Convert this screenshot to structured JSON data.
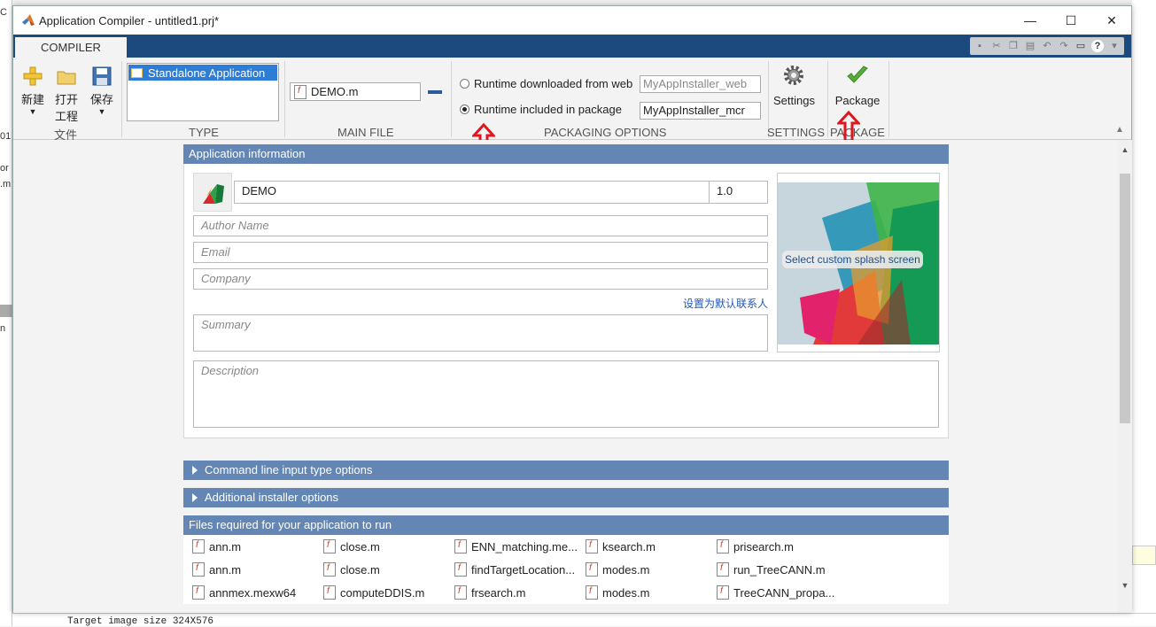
{
  "window": {
    "title": "Application Compiler - untitled1.prj*",
    "controls": {
      "minimize": "—",
      "maximize": "☐",
      "close": "✕"
    }
  },
  "tab": {
    "label": "COMPILER"
  },
  "ribbon": {
    "file_group": {
      "new_label": "新建",
      "open_label_1": "打开",
      "open_label_2": "工程",
      "save_label": "保存",
      "section": "文件"
    },
    "type": {
      "selected": "Standalone Application",
      "section": "TYPE"
    },
    "main_file": {
      "value": "DEMO.m",
      "section": "MAIN FILE"
    },
    "packaging": {
      "option_web": "Runtime downloaded from web",
      "option_included": "Runtime included in package",
      "web_installer_name": "MyAppInstaller_web",
      "mcr_installer_name": "MyAppInstaller_mcr",
      "selected": "Runtime included in package",
      "section": "PACKAGING OPTIONS"
    },
    "settings": {
      "label": "Settings",
      "section": "SETTINGS"
    },
    "package": {
      "label": "Package",
      "section": "PACKAGE"
    }
  },
  "app_info": {
    "header": "Application information",
    "app_name": "DEMO",
    "version": "1.0",
    "author_placeholder": "Author Name",
    "email_placeholder": "Email",
    "company_placeholder": "Company",
    "set_default_contact": "设置为默认联系人",
    "summary_placeholder": "Summary",
    "description_placeholder": "Description",
    "splash_button": "Select custom splash screen"
  },
  "sections": {
    "command_line": "Command line input type options",
    "installer": "Additional installer options",
    "files_required": "Files required for your application to run"
  },
  "files": [
    "ann.m",
    "close.m",
    "ENN_matching.me...",
    "ksearch.m",
    "prisearch.m",
    "ann.m",
    "close.m",
    "findTargetLocation...",
    "modes.m",
    "run_TreeCANN.m",
    "annmex.mexw64",
    "computeDDIS.m",
    "frsearch.m",
    "modes.m",
    "TreeCANN_propa..."
  ],
  "background": {
    "bottom_text": "Target image size 324X576",
    "left_fragments": [
      "C",
      "01",
      "or",
      ".m",
      "n"
    ]
  },
  "colors": {
    "ribbon_tab_bar": "#1c4a7e",
    "panel_header": "#6386b4",
    "selection": "#2d7cd6",
    "annotation_arrow": "#e0161c"
  }
}
